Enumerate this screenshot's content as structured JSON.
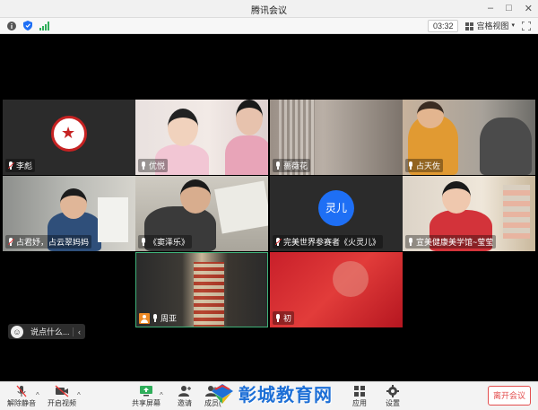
{
  "window": {
    "title": "腾讯会议"
  },
  "toolbar": {
    "timer": "03:32",
    "view_label": "宫格视图"
  },
  "participants": [
    {
      "name": "李彪"
    },
    {
      "name": "优悦"
    },
    {
      "name": "薔薇花"
    },
    {
      "name": "占天佐"
    },
    {
      "name": "占君妤，占云翠妈妈"
    },
    {
      "name": "《窦泽乐》"
    },
    {
      "name": "完美世界参赛者《火灵儿》",
      "avatar_text": "灵儿"
    },
    {
      "name": "宣美健康美学馆~莹莹"
    },
    {
      "name": "周亚"
    },
    {
      "name": "初"
    }
  ],
  "chat": {
    "placeholder": "说点什么..."
  },
  "bottombar": {
    "mute_label": "解除静音",
    "video_label": "开启视频",
    "share_label": "共享屏幕",
    "invite_label": "邀请",
    "members_label": "成员(",
    "apps_label": "应用",
    "settings_label": "设置",
    "leave_label": "离开会议"
  },
  "watermark": {
    "text": "彰城教育网"
  },
  "colors": {
    "accent": "#1e6ff5",
    "leave": "#e34d4d",
    "speaker_border": "#3fb37a",
    "host_badge": "#f08a24"
  }
}
